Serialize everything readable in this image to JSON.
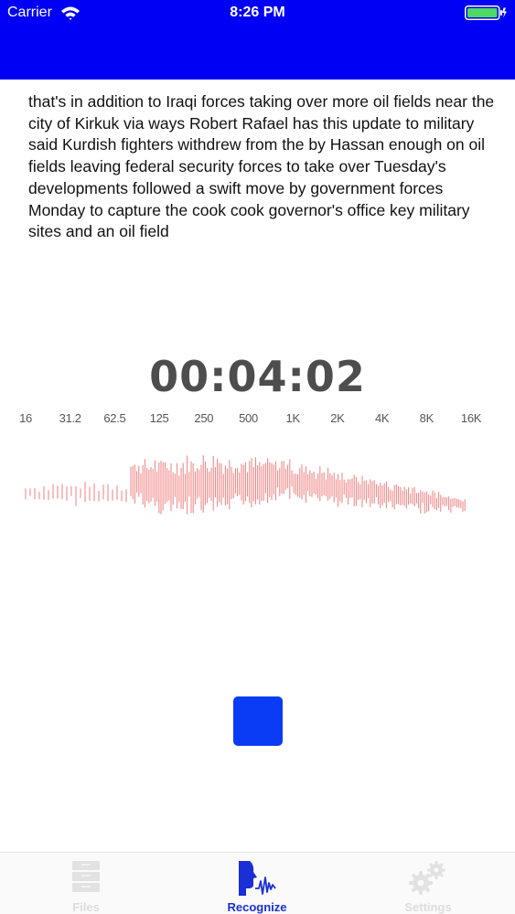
{
  "status_bar": {
    "carrier": "Carrier",
    "time": "8:26 PM"
  },
  "colors": {
    "header": "#0000f5",
    "accent": "#0a3cf5",
    "waveform": "#f07f7f",
    "timer_text": "#4d4d4d"
  },
  "transcript": "that's in addition to Iraqi forces taking over more oil fields near the city of Kirkuk via ways Robert Rafael has this update to military said Kurdish fighters withdrew from the by Hassan enough on oil fields leaving federal security forces to take over Tuesday's developments followed a swift move by government forces Monday to capture the cook cook governor's office key military sites and an oil field",
  "timer": "00:04:02",
  "frequency_labels": [
    "16",
    "31.2",
    "62.5",
    "125",
    "250",
    "500",
    "1K",
    "2K",
    "4K",
    "8K",
    "16K"
  ],
  "stop_button": {
    "icon": "stop-icon"
  },
  "tabs": [
    {
      "label": "Files",
      "icon": "files-icon",
      "active": false
    },
    {
      "label": "Recognize",
      "icon": "recognize-icon",
      "active": true
    },
    {
      "label": "Settings",
      "icon": "gear-icon",
      "active": false
    }
  ]
}
